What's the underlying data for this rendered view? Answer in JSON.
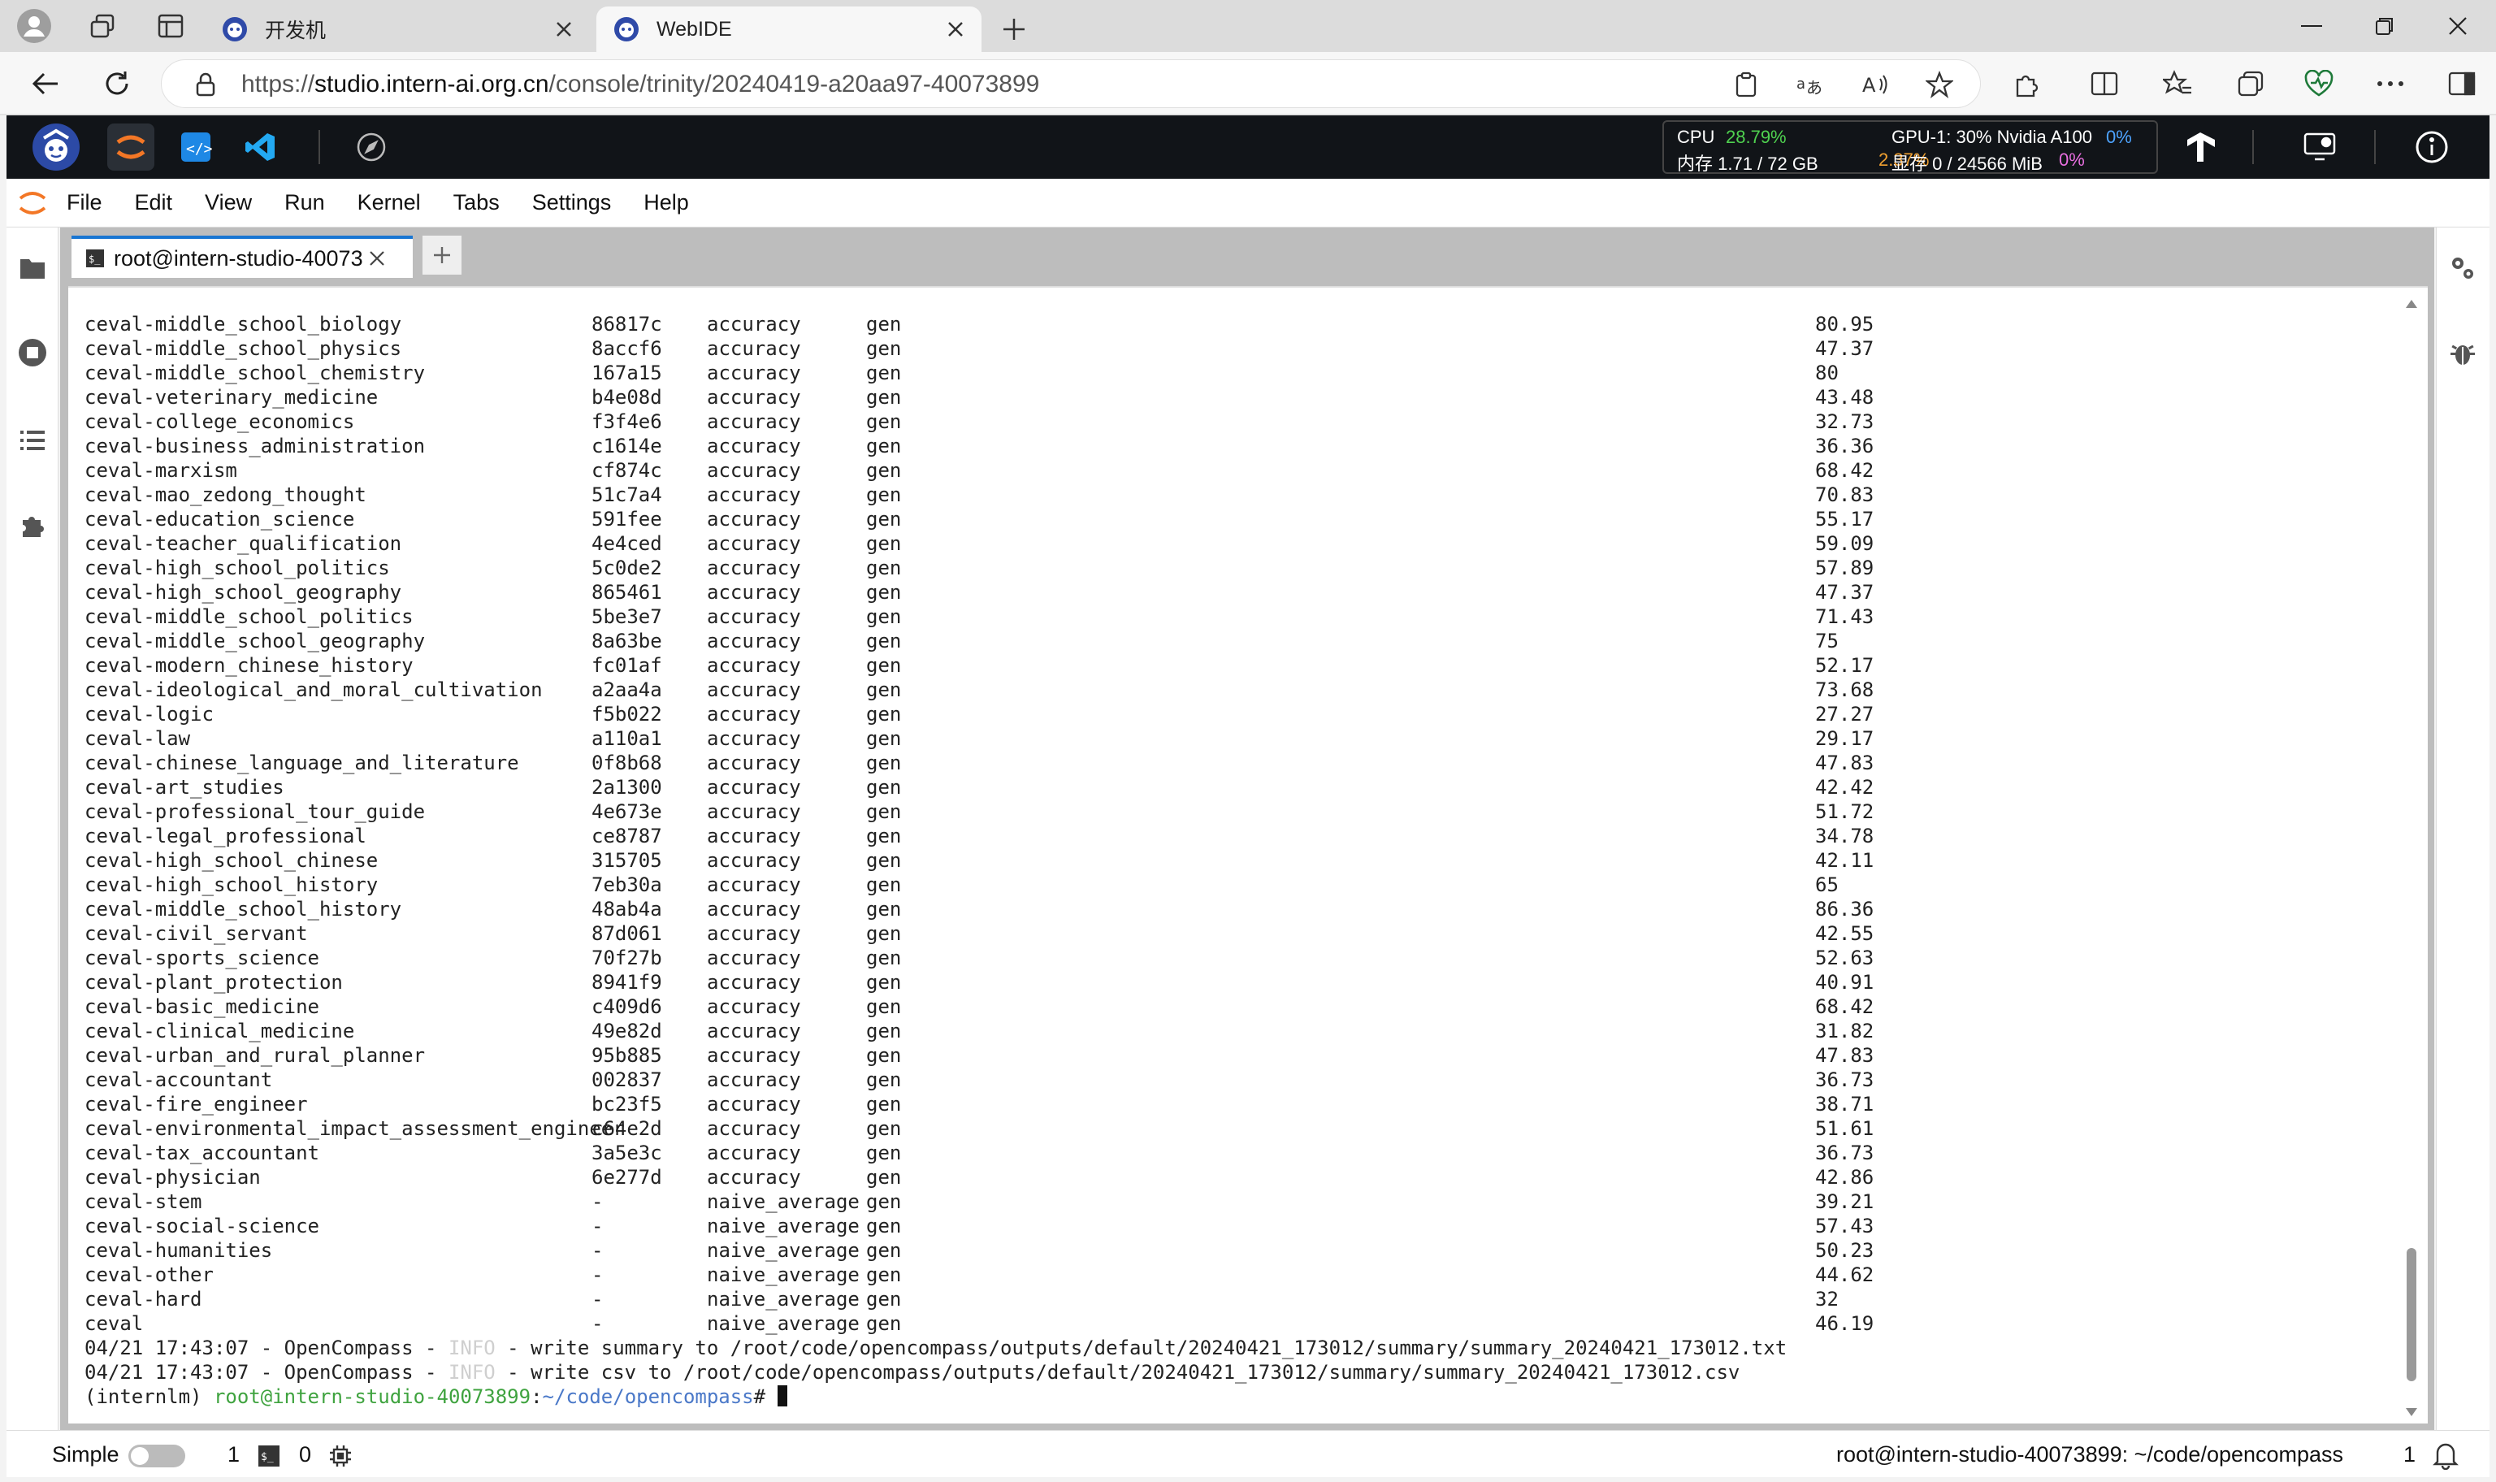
{
  "browser": {
    "tabs": [
      {
        "title": "开发机",
        "active": false
      },
      {
        "title": "WebIDE",
        "active": true
      }
    ],
    "url_prefix": "https://",
    "url_host": "studio.intern-ai.org.cn",
    "url_path": "/console/trinity/20240419-a20aa97-40073899"
  },
  "stats": {
    "cpu_label": "CPU",
    "cpu_value": "28.79%",
    "mem_label": "内存 1.71 / 72 GB",
    "mem_value": "2.37%",
    "gpu_label": "GPU-1: 30% Nvidia A100",
    "gpu_value": "0%",
    "vram_label": "显存 0 / 24566 MiB",
    "vram_value": "0%"
  },
  "menubar": [
    "File",
    "Edit",
    "View",
    "Run",
    "Kernel",
    "Tabs",
    "Settings",
    "Help"
  ],
  "doc_tab": {
    "title": "root@intern-studio-40073"
  },
  "terminal": {
    "rows": [
      [
        "ceval-middle_school_biology",
        "86817c",
        "accuracy",
        "gen",
        "80.95"
      ],
      [
        "ceval-middle_school_physics",
        "8accf6",
        "accuracy",
        "gen",
        "47.37"
      ],
      [
        "ceval-middle_school_chemistry",
        "167a15",
        "accuracy",
        "gen",
        "80"
      ],
      [
        "ceval-veterinary_medicine",
        "b4e08d",
        "accuracy",
        "gen",
        "43.48"
      ],
      [
        "ceval-college_economics",
        "f3f4e6",
        "accuracy",
        "gen",
        "32.73"
      ],
      [
        "ceval-business_administration",
        "c1614e",
        "accuracy",
        "gen",
        "36.36"
      ],
      [
        "ceval-marxism",
        "cf874c",
        "accuracy",
        "gen",
        "68.42"
      ],
      [
        "ceval-mao_zedong_thought",
        "51c7a4",
        "accuracy",
        "gen",
        "70.83"
      ],
      [
        "ceval-education_science",
        "591fee",
        "accuracy",
        "gen",
        "55.17"
      ],
      [
        "ceval-teacher_qualification",
        "4e4ced",
        "accuracy",
        "gen",
        "59.09"
      ],
      [
        "ceval-high_school_politics",
        "5c0de2",
        "accuracy",
        "gen",
        "57.89"
      ],
      [
        "ceval-high_school_geography",
        "865461",
        "accuracy",
        "gen",
        "47.37"
      ],
      [
        "ceval-middle_school_politics",
        "5be3e7",
        "accuracy",
        "gen",
        "71.43"
      ],
      [
        "ceval-middle_school_geography",
        "8a63be",
        "accuracy",
        "gen",
        "75"
      ],
      [
        "ceval-modern_chinese_history",
        "fc01af",
        "accuracy",
        "gen",
        "52.17"
      ],
      [
        "ceval-ideological_and_moral_cultivation",
        "a2aa4a",
        "accuracy",
        "gen",
        "73.68"
      ],
      [
        "ceval-logic",
        "f5b022",
        "accuracy",
        "gen",
        "27.27"
      ],
      [
        "ceval-law",
        "a110a1",
        "accuracy",
        "gen",
        "29.17"
      ],
      [
        "ceval-chinese_language_and_literature",
        "0f8b68",
        "accuracy",
        "gen",
        "47.83"
      ],
      [
        "ceval-art_studies",
        "2a1300",
        "accuracy",
        "gen",
        "42.42"
      ],
      [
        "ceval-professional_tour_guide",
        "4e673e",
        "accuracy",
        "gen",
        "51.72"
      ],
      [
        "ceval-legal_professional",
        "ce8787",
        "accuracy",
        "gen",
        "34.78"
      ],
      [
        "ceval-high_school_chinese",
        "315705",
        "accuracy",
        "gen",
        "42.11"
      ],
      [
        "ceval-high_school_history",
        "7eb30a",
        "accuracy",
        "gen",
        "65"
      ],
      [
        "ceval-middle_school_history",
        "48ab4a",
        "accuracy",
        "gen",
        "86.36"
      ],
      [
        "ceval-civil_servant",
        "87d061",
        "accuracy",
        "gen",
        "42.55"
      ],
      [
        "ceval-sports_science",
        "70f27b",
        "accuracy",
        "gen",
        "52.63"
      ],
      [
        "ceval-plant_protection",
        "8941f9",
        "accuracy",
        "gen",
        "40.91"
      ],
      [
        "ceval-basic_medicine",
        "c409d6",
        "accuracy",
        "gen",
        "68.42"
      ],
      [
        "ceval-clinical_medicine",
        "49e82d",
        "accuracy",
        "gen",
        "31.82"
      ],
      [
        "ceval-urban_and_rural_planner",
        "95b885",
        "accuracy",
        "gen",
        "47.83"
      ],
      [
        "ceval-accountant",
        "002837",
        "accuracy",
        "gen",
        "36.73"
      ],
      [
        "ceval-fire_engineer",
        "bc23f5",
        "accuracy",
        "gen",
        "38.71"
      ],
      [
        "ceval-environmental_impact_assessment_engineer",
        "c64e2d",
        "accuracy",
        "gen",
        "51.61"
      ],
      [
        "ceval-tax_accountant",
        "3a5e3c",
        "accuracy",
        "gen",
        "36.73"
      ],
      [
        "ceval-physician",
        "6e277d",
        "accuracy",
        "gen",
        "42.86"
      ],
      [
        "ceval-stem",
        "-",
        "naive_average",
        "gen",
        "39.21"
      ],
      [
        "ceval-social-science",
        "-",
        "naive_average",
        "gen",
        "57.43"
      ],
      [
        "ceval-humanities",
        "-",
        "naive_average",
        "gen",
        "50.23"
      ],
      [
        "ceval-other",
        "-",
        "naive_average",
        "gen",
        "44.62"
      ],
      [
        "ceval-hard",
        "-",
        "naive_average",
        "gen",
        "32"
      ],
      [
        "ceval",
        "-",
        "naive_average",
        "gen",
        "46.19"
      ]
    ],
    "log1_prefix": "04/21 17:43:07 - OpenCompass - ",
    "log1_level": "INFO",
    "log1_suffix": " - write summary to /root/code/opencompass/outputs/default/20240421_173012/summary/summary_20240421_173012.txt",
    "log2_prefix": "04/21 17:43:07 - OpenCompass - ",
    "log2_level": "INFO",
    "log2_suffix": " - write csv to /root/code/opencompass/outputs/default/20240421_173012/summary/summary_20240421_173012.csv",
    "prompt_env": "(internlm) ",
    "prompt_user": "root@intern-studio-40073899",
    "prompt_colon": ":",
    "prompt_path": "~/code/opencompass",
    "prompt_hash": "# "
  },
  "statusbar": {
    "mode_label": "Simple",
    "terminals_count": "1",
    "kernels_count": "0",
    "right_text": "root@intern-studio-40073899: ~/code/opencompass",
    "notif_count": "1"
  }
}
